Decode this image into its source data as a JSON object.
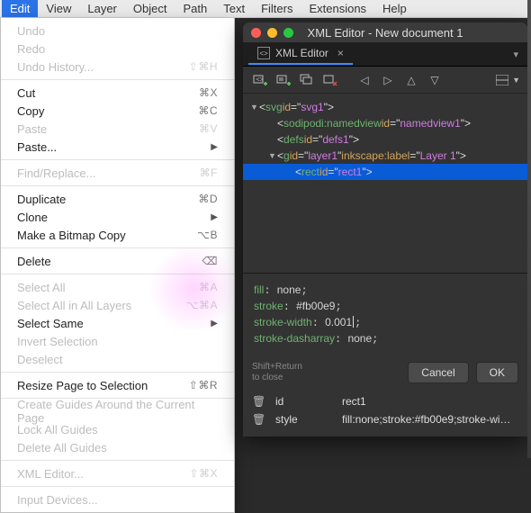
{
  "menubar": {
    "items": [
      {
        "label": "Edit",
        "active": true
      },
      {
        "label": "View"
      },
      {
        "label": "Layer"
      },
      {
        "label": "Object"
      },
      {
        "label": "Path"
      },
      {
        "label": "Text"
      },
      {
        "label": "Filters"
      },
      {
        "label": "Extensions"
      },
      {
        "label": "Help"
      }
    ]
  },
  "editMenu": {
    "groups": [
      [
        {
          "label": "Undo",
          "disabled": true
        },
        {
          "label": "Redo",
          "disabled": true
        },
        {
          "label": "Undo History...",
          "shortcut": "⇧⌘H",
          "disabled": true
        }
      ],
      [
        {
          "label": "Cut",
          "shortcut": "⌘X"
        },
        {
          "label": "Copy",
          "shortcut": "⌘C"
        },
        {
          "label": "Paste",
          "shortcut": "⌘V",
          "disabled": true
        },
        {
          "label": "Paste...",
          "submenu": true
        }
      ],
      [
        {
          "label": "Find/Replace...",
          "shortcut": "⌘F",
          "disabled": true
        }
      ],
      [
        {
          "label": "Duplicate",
          "shortcut": "⌘D"
        },
        {
          "label": "Clone",
          "submenu": true
        },
        {
          "label": "Make a Bitmap Copy",
          "shortcut": "⌥B"
        }
      ],
      [
        {
          "label": "Delete",
          "shortcut": "⌫"
        }
      ],
      [
        {
          "label": "Select All",
          "shortcut": "⌘A",
          "disabled": true
        },
        {
          "label": "Select All in All Layers",
          "shortcut": "⌥⌘A",
          "disabled": true
        },
        {
          "label": "Select Same",
          "submenu": true
        },
        {
          "label": "Invert Selection",
          "disabled": true
        },
        {
          "label": "Deselect",
          "disabled": true
        }
      ],
      [
        {
          "label": "Resize Page to Selection",
          "shortcut": "⇧⌘R"
        }
      ],
      [
        {
          "label": "Create Guides Around the Current Page",
          "disabled": true
        },
        {
          "label": "Lock All Guides",
          "disabled": true
        },
        {
          "label": "Delete All Guides",
          "disabled": true
        }
      ],
      [
        {
          "label": "XML Editor...",
          "shortcut": "⇧⌘X",
          "disabled": true
        }
      ],
      [
        {
          "label": "Input Devices...",
          "disabled": true
        }
      ]
    ]
  },
  "xmlWindow": {
    "title": "XML Editor - New document 1",
    "tab": "XML Editor",
    "tree": [
      {
        "depth": 0,
        "tri": "▼",
        "tag": "svg",
        "attrs": [
          {
            "k": "id",
            "v": "svg1"
          }
        ]
      },
      {
        "depth": 1,
        "tag": "sodipodi:namedview",
        "attrs": [
          {
            "k": "id",
            "v": "namedview1"
          }
        ]
      },
      {
        "depth": 1,
        "tag": "defs",
        "attrs": [
          {
            "k": "id",
            "v": "defs1"
          }
        ]
      },
      {
        "depth": 1,
        "tri": "▼",
        "tag": "g",
        "attrs": [
          {
            "k": "id",
            "v": "layer1"
          },
          {
            "k": "inkscape:label",
            "v": "Layer 1"
          }
        ]
      },
      {
        "depth": 2,
        "sel": true,
        "tag": "rect",
        "attrs": [
          {
            "k": "id",
            "v": "rect1"
          }
        ]
      }
    ],
    "styleLines": [
      {
        "prop": "fill",
        "val": "none"
      },
      {
        "prop": "stroke",
        "val": "#fb00e9"
      },
      {
        "prop": "stroke-width",
        "val": "0.001",
        "cursor": true
      },
      {
        "prop": "stroke-dasharray",
        "val": "none"
      }
    ],
    "hint": {
      "line1": "Shift+Return",
      "line2": "to close"
    },
    "buttons": {
      "cancel": "Cancel",
      "ok": "OK"
    },
    "attrs": [
      {
        "name": "id",
        "value": "rect1"
      },
      {
        "name": "style",
        "value": "fill:none;stroke:#fb00e9;stroke-wi…"
      }
    ]
  }
}
